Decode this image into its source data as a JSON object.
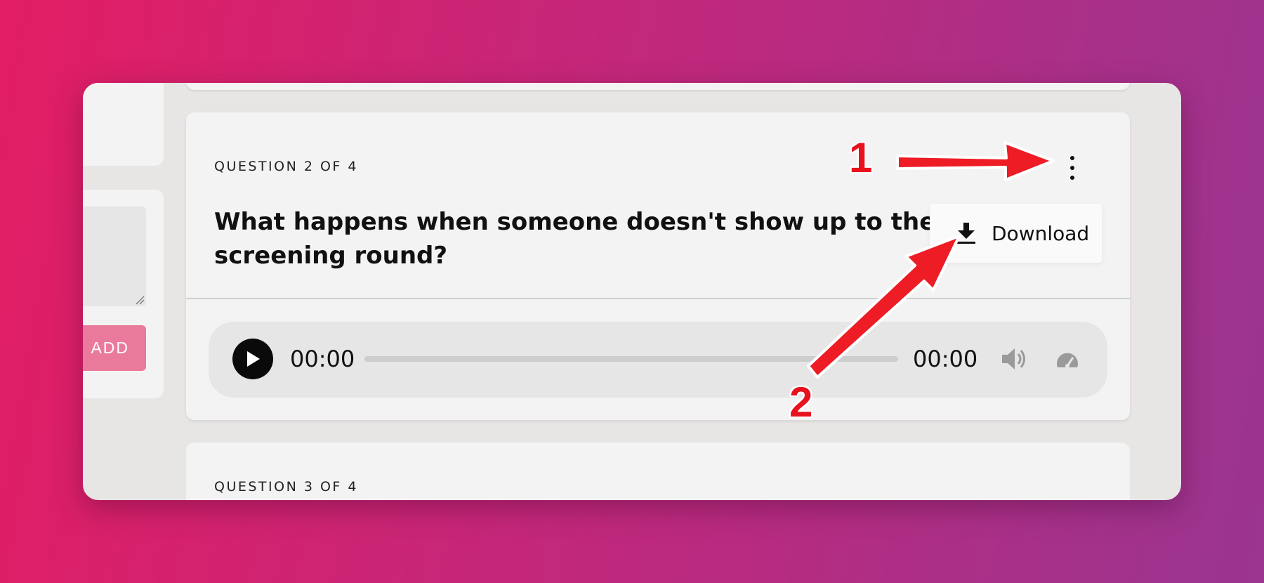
{
  "sidebar": {
    "add_label": "ADD"
  },
  "question2": {
    "label": "QUESTION 2 OF 4",
    "title": "What happens when someone doesn't show up to the screening round?",
    "menu": {
      "download_label": "Download"
    },
    "player": {
      "current_time": "00:00",
      "total_time": "00:00",
      "progress": 0
    }
  },
  "question3": {
    "label": "QUESTION 3 OF 4"
  },
  "annotations": {
    "step1": "1",
    "step2": "2",
    "color": "#e8121c"
  },
  "colors": {
    "accent_pink": "#ea7a9b",
    "background_start": "#e21d63",
    "background_end": "#9a3590"
  }
}
